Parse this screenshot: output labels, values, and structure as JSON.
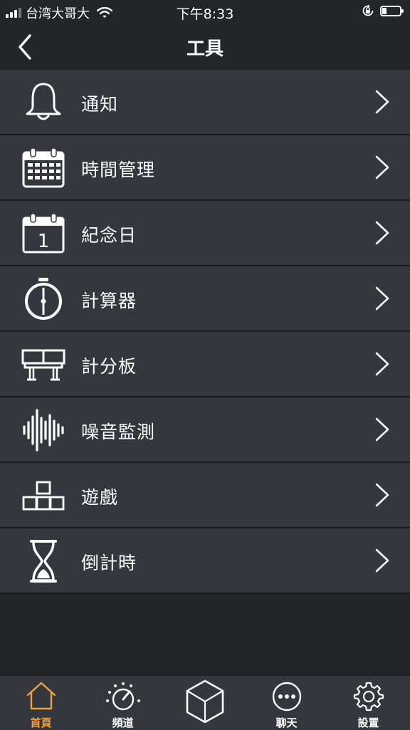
{
  "status_bar": {
    "carrier": "台湾大哥大",
    "time": "下午8:33",
    "battery_level": 0.25
  },
  "nav": {
    "title": "工具",
    "back_icon": "chevron-left-icon"
  },
  "menu_items": [
    {
      "label": "通知",
      "icon": "bell-icon"
    },
    {
      "label": "時間管理",
      "icon": "calendar-grid-icon"
    },
    {
      "label": "紀念日",
      "icon": "calendar-day-icon"
    },
    {
      "label": "計算器",
      "icon": "stopwatch-icon"
    },
    {
      "label": "計分板",
      "icon": "scoreboard-icon"
    },
    {
      "label": "噪音監測",
      "icon": "sound-wave-icon"
    },
    {
      "label": "遊戲",
      "icon": "blocks-icon"
    },
    {
      "label": "倒計時",
      "icon": "hourglass-icon"
    }
  ],
  "calendar_day_number": "1",
  "tab_bar": {
    "tabs": [
      {
        "label": "首頁",
        "icon": "home-icon",
        "active": true
      },
      {
        "label": "頻道",
        "icon": "channel-dial-icon",
        "active": false
      },
      {
        "label": "",
        "icon": "cube-icon",
        "active": false
      },
      {
        "label": "聊天",
        "icon": "chat-bubble-icon",
        "active": false
      },
      {
        "label": "設置",
        "icon": "gear-icon",
        "active": false
      }
    ]
  },
  "colors": {
    "background": "#232529",
    "row_background": "#34373d",
    "divider": "#17181b",
    "active_tab": "#f2a23a",
    "text": "#ffffff"
  }
}
